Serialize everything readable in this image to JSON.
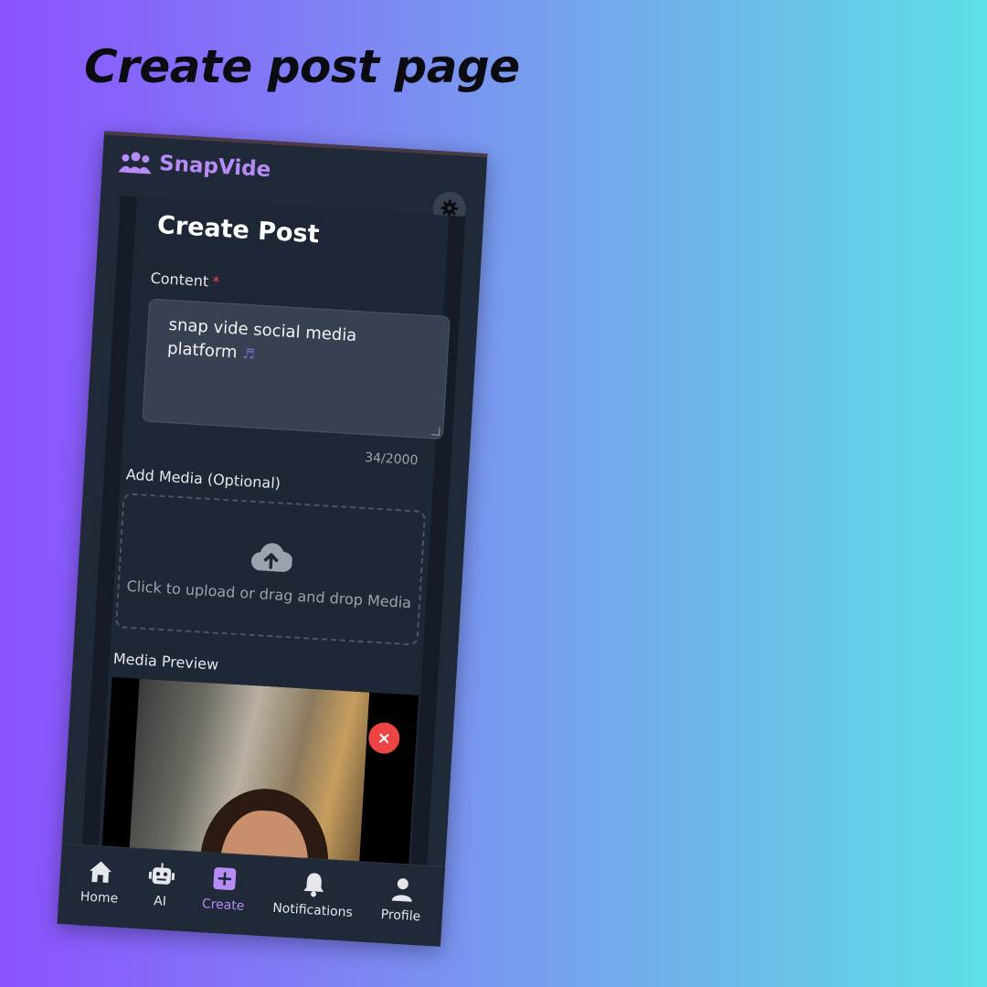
{
  "headline": "Create post page",
  "app": {
    "brand": "SnapVide"
  },
  "form": {
    "title": "Create Post",
    "content_label": "Content",
    "required_mark": "*",
    "content_value": "snap vide social media platform",
    "content_icon": "music-notes-icon",
    "char_counter": "34/2000",
    "media_label": "Add Media (Optional)",
    "dropzone_text": "Click to upload or drag and drop Media",
    "preview_label": "Media Preview",
    "remove_label": "×"
  },
  "nav": [
    {
      "label": "Home",
      "icon": "home-icon"
    },
    {
      "label": "AI",
      "icon": "robot-icon"
    },
    {
      "label": "Create",
      "icon": "plus-square-icon",
      "active": true
    },
    {
      "label": "Notifications",
      "icon": "bell-icon"
    },
    {
      "label": "Profile",
      "icon": "user-icon"
    }
  ],
  "colors": {
    "accent": "#b78cf7",
    "panel": "#1f2937",
    "danger": "#ef4444"
  }
}
